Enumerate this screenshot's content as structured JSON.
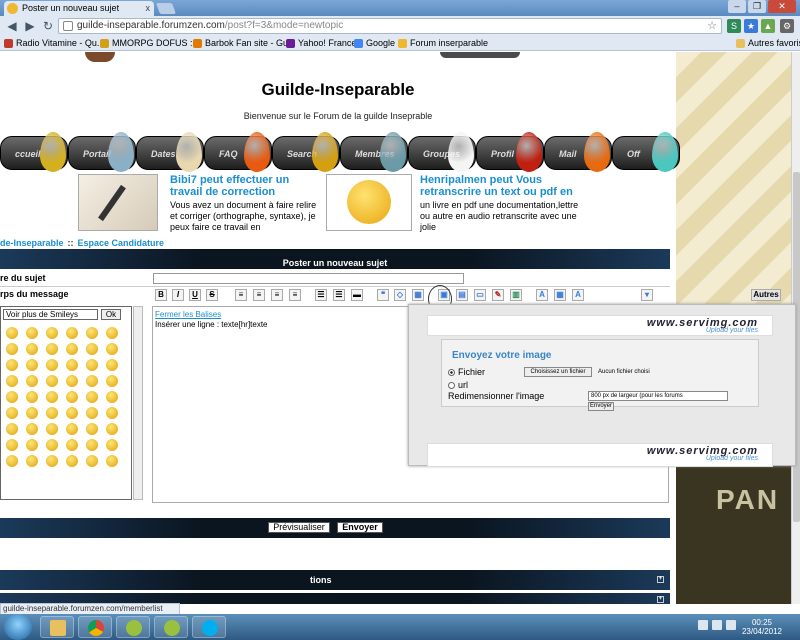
{
  "browser": {
    "tab_title": "Poster un nouveau sujet",
    "tab_close": "x",
    "window_controls": [
      "–",
      "❐",
      "✕"
    ],
    "url_domain": "guilde-inseparable.forumzen.com",
    "url_path": "/post?f=3&mode=newtopic",
    "bookmarks": [
      {
        "label": "Radio Vitamine - Qu...",
        "color": "#c0392b"
      },
      {
        "label": "MMORPG DOFUS ::...",
        "color": "#d4a017"
      },
      {
        "label": "Barbok Fan site - Gu...",
        "color": "#e07b00"
      },
      {
        "label": "Yahoo! France",
        "color": "#6a1b9a"
      },
      {
        "label": "Google",
        "color": "#4285f4"
      },
      {
        "label": "Forum inserparable",
        "color": "#f0b830"
      }
    ],
    "other_bookmarks": "Autres favoris",
    "status_url": "guilde-inseparable.forumzen.com/memberlist"
  },
  "site": {
    "title": "Guilde-Inseparable",
    "welcome": "Bienvenue sur le Forum de la guilde Inseprable",
    "menu": [
      {
        "label": "ccueil",
        "egg": "#d4b020"
      },
      {
        "label": "Portail",
        "egg": "#8ab0c8"
      },
      {
        "label": "Dates",
        "egg": "#e8d8b0"
      },
      {
        "label": "FAQ",
        "egg": "#e85a10"
      },
      {
        "label": "Search",
        "egg": "#d4a010"
      },
      {
        "label": "Membres",
        "egg": "#6a9aa8"
      },
      {
        "label": "Groupes",
        "egg": "#f4f4f4"
      },
      {
        "label": "Profil",
        "egg": "#c02010"
      },
      {
        "label": "Mail",
        "egg": "#e86a10"
      },
      {
        "label": "Off",
        "egg": "#4ac8c0"
      }
    ]
  },
  "ads": [
    {
      "title": "Bibi7 peut effectuer un travail de correction",
      "text": "Vous avez un document à faire relire et corriger (orthographe, syntaxe), je peux faire ce travail en"
    },
    {
      "title": "Henripalmen peut Vous retranscrire un text ou pdf en",
      "text": "un livre en pdf une documentation,lettre ou autre en audio retranscrite avec une jolie"
    }
  ],
  "breadcrumb": {
    "forum": "de-Inseparable",
    "separator": "::",
    "section": "Espace Candidature"
  },
  "form": {
    "header": "Poster un nouveau sujet",
    "subject_label": "re du sujet",
    "subject_value": "",
    "body_label": "rps du message",
    "smiley_select": "Voir plus de Smileys",
    "smiley_ok": "Ok",
    "toolbar": [
      "B",
      "I",
      "U",
      "S"
    ],
    "autres": "Autres",
    "close_tags": "Fermer les Balises",
    "hint": "Insérer une ligne : texte[hr]texte",
    "preview_button": "Prévisualiser",
    "send_button": "Envoyer"
  },
  "servimg": {
    "logo": "www.servimg.com",
    "tagline": "Upload your files",
    "title": "Envoyez votre image",
    "option_file": "Fichier",
    "choose_file": "Choisissez un fichier",
    "no_file": "Aucun fichier choisi",
    "option_url": "url",
    "resize_label": "Redimensionner l'image",
    "resize_value": "800 px de largeur (pour les forums",
    "send": "Envoyer"
  },
  "bars": {
    "section2": "tions",
    "expand": "+"
  },
  "taskbar": {
    "time": "00:25",
    "date": "23/04/2012"
  }
}
